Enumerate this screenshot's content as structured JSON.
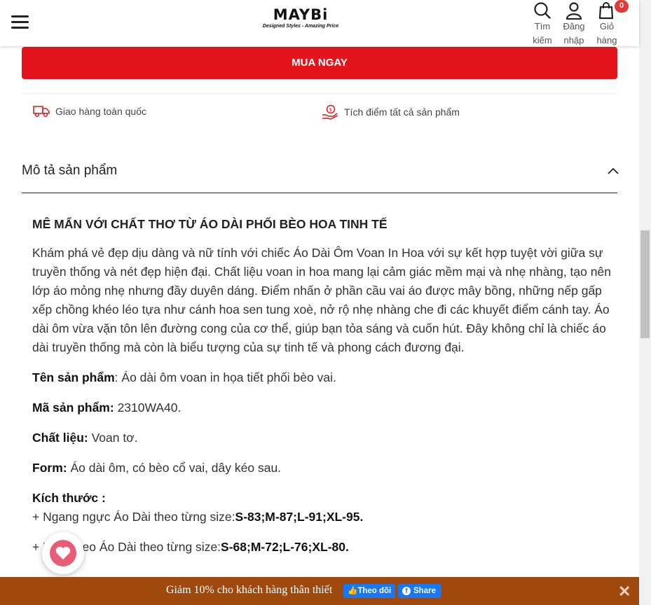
{
  "header": {
    "logo": "MAYBi",
    "tagline": "Designed Styles - Amazing Price",
    "search_line1": "Tìm",
    "search_line2": "kiếm",
    "login_line1": "Đăng",
    "login_line2": "nhập",
    "cart_line1": "Giỏ",
    "cart_line2": "hàng",
    "cart_count": "0"
  },
  "buy_now": "MUA NGAY",
  "features": {
    "shipping": "Giao hàng toàn quốc",
    "points": "Tích điểm tất cả sản phẩm"
  },
  "section_title": "Mô tả sản phẩm",
  "description": {
    "heading": "MÊ MẨN VỚI CHẤT THƠ TỪ ÁO DÀI PHỐI BÈO HOA TINH TẾ",
    "intro": "Khám phá vẻ đẹp dịu dàng và nữ tính với chiếc Áo Dài Ôm Voan In Hoa với sự kết hợp tuyệt vời giữa sự truyền thống và nét đẹp hiện đại. Chất liệu voan in hoa mang lại cảm giác mềm mại và nhẹ nhàng, tạo nên lớp áo mỏng nhẹ nhưng đầy duyên dáng. Điểm nhấn ở phần cầu vai áo được mây bồng, những nếp gấp xếp chồng khéo léo tựa như cánh hoa sen tung xoè, nở rộ nhẹ nhàng che đi các khuyết điểm cánh tay. Áo dài ôm vừa vặn tôn lên đường cong của cơ thể, giúp bạn tỏa sáng và cuốn hút. Đây không chỉ là chiếc áo dài truyền thống mà còn là biểu tượng của sự tinh tế và phong cách đương đại.",
    "name_label": "Tên sản phẩm",
    "name_value": ": Áo dài ôm voan in họa tiết phối bèo vai.",
    "code_label": "Mã sản phẩm:",
    "code_value": " 2310WA40.",
    "material_label": "Chất liệu:",
    "material_value": " Voan tơ.",
    "form_label": "Form:",
    "form_value": " Áo dài ôm, có bèo cổ vai, dây kéo sau.",
    "size_label": "Kích thước :",
    "size_line1_text": "+ Ngang ngực Áo Dài theo từng size:",
    "size_line1_values": "S-83;M-87;L-91;XL-95.",
    "size_line2_text": "+ Ngang eo Áo Dài theo từng size:",
    "size_line2_values": "S-68;M-72;L-76;XL-80."
  },
  "bottom_bar": {
    "promo": "Giảm 10% cho khách hàng thân thiết",
    "follow": "Theo dõi",
    "share": "Share"
  }
}
